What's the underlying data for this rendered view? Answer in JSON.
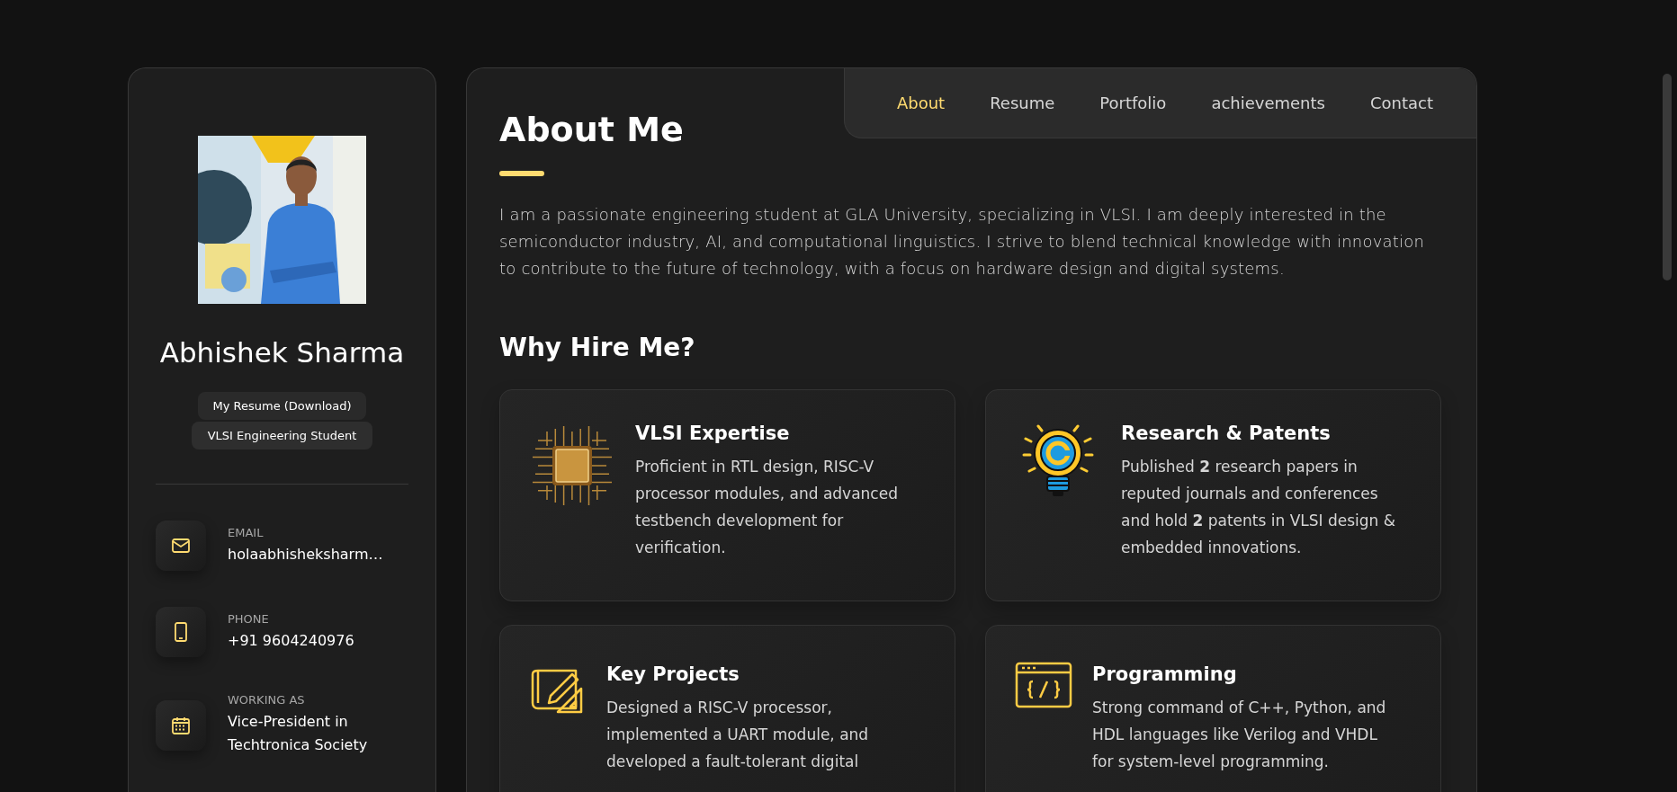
{
  "profile": {
    "name": "Abhishek Sharma",
    "badges": [
      {
        "kind": "link",
        "label": "My Resume (Download)"
      },
      {
        "kind": "title",
        "label": "VLSI Engineering Student"
      }
    ]
  },
  "contacts": [
    {
      "kind": "email",
      "label": "EMAIL",
      "value": "holaabhisheksharm…"
    },
    {
      "kind": "phone",
      "label": "PHONE",
      "value": "+91 9604240976"
    },
    {
      "kind": "calendar",
      "label": "WORKING AS",
      "value": "Vice-President in Techtronica Society"
    }
  ],
  "nav": [
    {
      "label": "About",
      "selected": true
    },
    {
      "label": "Resume",
      "selected": false
    },
    {
      "label": "Portfolio",
      "selected": false
    },
    {
      "label": "achievements",
      "selected": false
    },
    {
      "label": "Contact",
      "selected": false
    }
  ],
  "about": {
    "title": "About Me",
    "text": "I am a passionate engineering student at GLA University, specializing in VLSI. I am deeply interested in the semiconductor industry, AI, and computational linguistics. I strive to blend technical knowledge with innovation to contribute to the future of technology, with a focus on hardware design and digital systems."
  },
  "why_hire": {
    "title": "Why Hire Me?",
    "cards": [
      {
        "kind": "chip",
        "title": "VLSI Expertise",
        "text": "Proficient in RTL design, RISC-V processor modules, and advanced testbench development for verification."
      },
      {
        "kind": "bulb",
        "title": "Research & Patents",
        "text": "Published **2** research papers in reputed journals and conferences and hold **2** patents in VLSI design & embedded innovations."
      },
      {
        "kind": "blueprint",
        "title": "Key Projects",
        "text": "Designed a RISC-V processor, implemented a UART module, and developed a fault-tolerant digital"
      },
      {
        "kind": "code",
        "title": "Programming",
        "text": "Strong command of C++, Python, and HDL languages like Verilog and VHDL for system-level programming."
      }
    ]
  }
}
